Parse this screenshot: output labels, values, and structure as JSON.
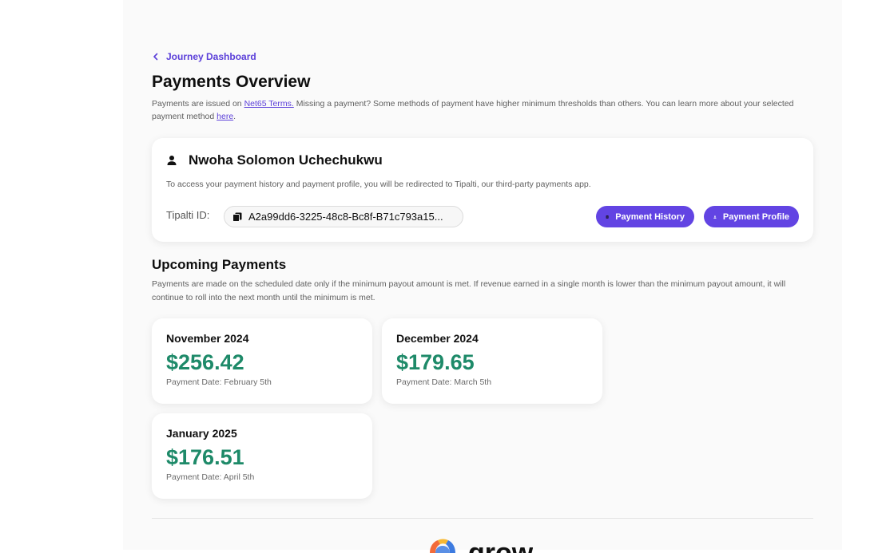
{
  "breadcrumb": {
    "label": "Journey Dashboard"
  },
  "page": {
    "title": "Payments Overview",
    "intro_before": "Payments are issued on ",
    "intro_link": "Net65 Terms.",
    "intro_middle": " Missing a payment? Some methods of payment have higher minimum thresholds than others. You can learn more about your selected payment method ",
    "intro_link2": "here",
    "intro_after": "."
  },
  "profile": {
    "name": "Nwoha Solomon Uchechukwu",
    "description": "To access your payment history and payment profile, you will be redirected to Tipalti, our third-party payments app.",
    "tipalti_label": "Tipalti ID:",
    "tipalti_id": "A2a99dd6-3225-48c8-Bc8f-B71c793a15...",
    "history_button": "Payment History",
    "profile_button": "Payment Profile",
    "accent_color": "#6244e3"
  },
  "upcoming": {
    "title": "Upcoming Payments",
    "description": "Payments are made on the scheduled date only if the minimum payout amount is met. If revenue earned in a single month is lower than the minimum payout amount, it will continue to roll into the next month until the minimum is met.",
    "amount_color": "#1e8a69",
    "payments": [
      {
        "month": "November 2024",
        "amount": "$256.42",
        "date": "Payment Date: February 5th"
      },
      {
        "month": "December 2024",
        "amount": "$179.65",
        "date": "Payment Date: March 5th"
      },
      {
        "month": "January 2025",
        "amount": "$176.51",
        "date": "Payment Date: April 5th"
      }
    ]
  },
  "footer": {
    "logo_text": "grow",
    "logo_icon": "grow-logo-icon"
  }
}
